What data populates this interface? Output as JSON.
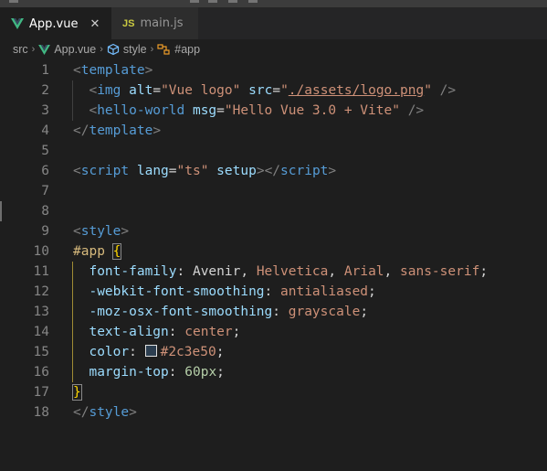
{
  "tabs": [
    {
      "label": "App.vue",
      "icon": "vue-icon",
      "active": true,
      "close": "✕"
    },
    {
      "label": "main.js",
      "icon": "js-icon",
      "active": false,
      "icon_text": "JS"
    }
  ],
  "breadcrumb": {
    "items": [
      {
        "label": "src",
        "icon": null
      },
      {
        "label": "App.vue",
        "icon": "vue-icon"
      },
      {
        "label": "style",
        "icon": "symbol-namespace-icon"
      },
      {
        "label": "#app",
        "icon": "symbol-selector-icon"
      }
    ],
    "separator": "›"
  },
  "editor": {
    "line_numbers": [
      "1",
      "2",
      "3",
      "4",
      "5",
      "6",
      "7",
      "8",
      "9",
      "10",
      "11",
      "12",
      "13",
      "14",
      "15",
      "16",
      "17",
      "18"
    ],
    "lines": {
      "l1": {
        "open": "<",
        "tag": "template",
        "close": ">"
      },
      "l2": {
        "indent": "  ",
        "open": "<",
        "tag": "img",
        "attr1": "alt",
        "eq": "=",
        "val1": "\"Vue logo\"",
        "attr2": "src",
        "val2_q1": "\"",
        "val2": "./assets/logo.png",
        "val2_q2": "\"",
        "end": " />"
      },
      "l3": {
        "indent": "  ",
        "open": "<",
        "tag": "hello-world",
        "attr1": "msg",
        "eq": "=",
        "val1": "\"Hello Vue 3.0 + Vite\"",
        "end": " />"
      },
      "l4": {
        "open": "</",
        "tag": "template",
        "close": ">"
      },
      "l6": {
        "open": "<",
        "tag": "script",
        "attr1": "lang",
        "eq": "=",
        "val1": "\"ts\"",
        "attr2": "setup",
        "close1": ">",
        "open2": "</",
        "tag2": "script",
        "close2": ">"
      },
      "l9": {
        "open": "<",
        "tag": "style",
        "close": ">"
      },
      "l10": {
        "selector": "#app",
        "brace": "{"
      },
      "l11": {
        "prop": "font-family",
        "v1": "Avenir",
        "v2": "Helvetica",
        "v3": "Arial",
        "v4": "sans-serif"
      },
      "l12": {
        "prop": "-webkit-font-smoothing",
        "val": "antialiased"
      },
      "l13": {
        "prop": "-moz-osx-font-smoothing",
        "val": "grayscale"
      },
      "l14": {
        "prop": "text-align",
        "val": "center"
      },
      "l15": {
        "prop": "color",
        "val": "#2c3e50",
        "swatch": "#2c3e50"
      },
      "l16": {
        "prop": "margin-top",
        "val": "60px"
      },
      "l17": {
        "brace": "}"
      },
      "l18": {
        "open": "</",
        "tag": "style",
        "close": ">"
      }
    }
  },
  "colors": {
    "background": "#1e1e1e",
    "tag": "#569cd6",
    "attribute": "#9cdcfe",
    "string": "#ce9178",
    "selector": "#d7ba7d",
    "number": "#b5cea8",
    "line_number": "#858585"
  }
}
